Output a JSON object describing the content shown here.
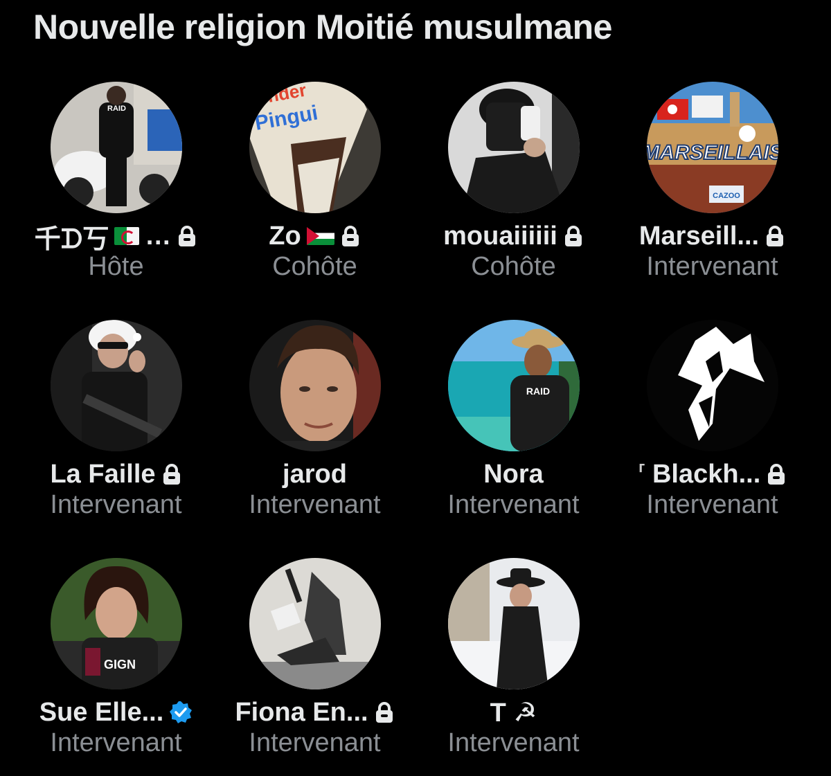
{
  "space": {
    "title": "Nouvelle religion Moitié musulmane"
  },
  "speakers": [
    {
      "name": "千ᗪ丂",
      "role": "Hôte",
      "flag": "algeria",
      "suffix": "…",
      "locked": true,
      "verified": false
    },
    {
      "name": "Zo",
      "role": "Cohôte",
      "flag": "palestine",
      "suffix": "",
      "locked": true,
      "verified": false
    },
    {
      "name": "mouaiiiiii",
      "role": "Cohôte",
      "flag": "",
      "suffix": "",
      "locked": true,
      "verified": false
    },
    {
      "name": "Marseill...",
      "role": "Intervenant",
      "flag": "",
      "suffix": "",
      "locked": true,
      "verified": false
    },
    {
      "name": "La Faille",
      "role": "Intervenant",
      "flag": "",
      "suffix": "",
      "locked": true,
      "verified": false
    },
    {
      "name": "jarod",
      "role": "Intervenant",
      "flag": "",
      "suffix": "",
      "locked": false,
      "verified": false
    },
    {
      "name": "Nora",
      "role": "Intervenant",
      "flag": "",
      "suffix": "",
      "locked": false,
      "verified": false
    },
    {
      "name": "Blackh...",
      "role": "Intervenant",
      "flag": "",
      "prefix": "⸢",
      "suffix": "",
      "locked": true,
      "verified": false
    },
    {
      "name": "Sue Elle...",
      "role": "Intervenant",
      "flag": "",
      "suffix": "",
      "locked": false,
      "verified": true
    },
    {
      "name": "Fiona En...",
      "role": "Intervenant",
      "flag": "",
      "suffix": "",
      "locked": true,
      "verified": false
    },
    {
      "name": "T ☭",
      "role": "Intervenant",
      "flag": "",
      "suffix": "",
      "locked": false,
      "verified": false
    }
  ],
  "avatar_texts": {
    "s1": "RAID",
    "s2a": "nder",
    "s2b": "Pingui",
    "s4a": "MARSEILLAIS",
    "s4b": "CAZOO",
    "s7": "RAID",
    "s9": "GIGN"
  },
  "colors": {
    "background": "#000000",
    "name": "#e7e9ea",
    "role": "#8b8f94",
    "verified": "#1d9bf0"
  }
}
